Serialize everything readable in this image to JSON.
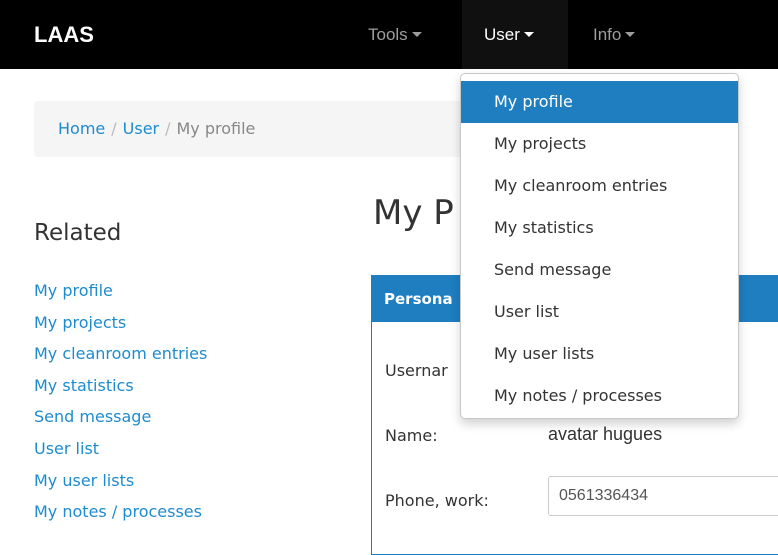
{
  "navbar": {
    "brand": "LAAS",
    "tools": "Tools",
    "user": "User",
    "info": "Info"
  },
  "breadcrumb": {
    "home": "Home",
    "user": "User",
    "current": "My profile",
    "separator": "/"
  },
  "sidebar": {
    "heading": "Related",
    "items": [
      {
        "label": "My profile"
      },
      {
        "label": "My projects"
      },
      {
        "label": "My cleanroom entries"
      },
      {
        "label": "My statistics"
      },
      {
        "label": "Send message"
      },
      {
        "label": "User list"
      },
      {
        "label": "My user lists"
      },
      {
        "label": "My notes / processes"
      }
    ]
  },
  "main": {
    "title": "My P",
    "panel_title": "Persona",
    "username_label": "Usernar",
    "name_label": "Name:",
    "name_value": "avatar hugues",
    "phone_label": "Phone, work:",
    "phone_value": "0561336434"
  },
  "dropdown": {
    "items": [
      {
        "label": "My profile",
        "active": true
      },
      {
        "label": "My projects"
      },
      {
        "label": "My cleanroom entries"
      },
      {
        "label": "My statistics"
      },
      {
        "label": "Send message"
      },
      {
        "label": "User list"
      },
      {
        "label": "My user lists"
      },
      {
        "label": "My notes / processes"
      }
    ]
  },
  "colors": {
    "navbar_bg": "#000000",
    "link": "#1e8bcf",
    "accent": "#1e7ec0"
  }
}
